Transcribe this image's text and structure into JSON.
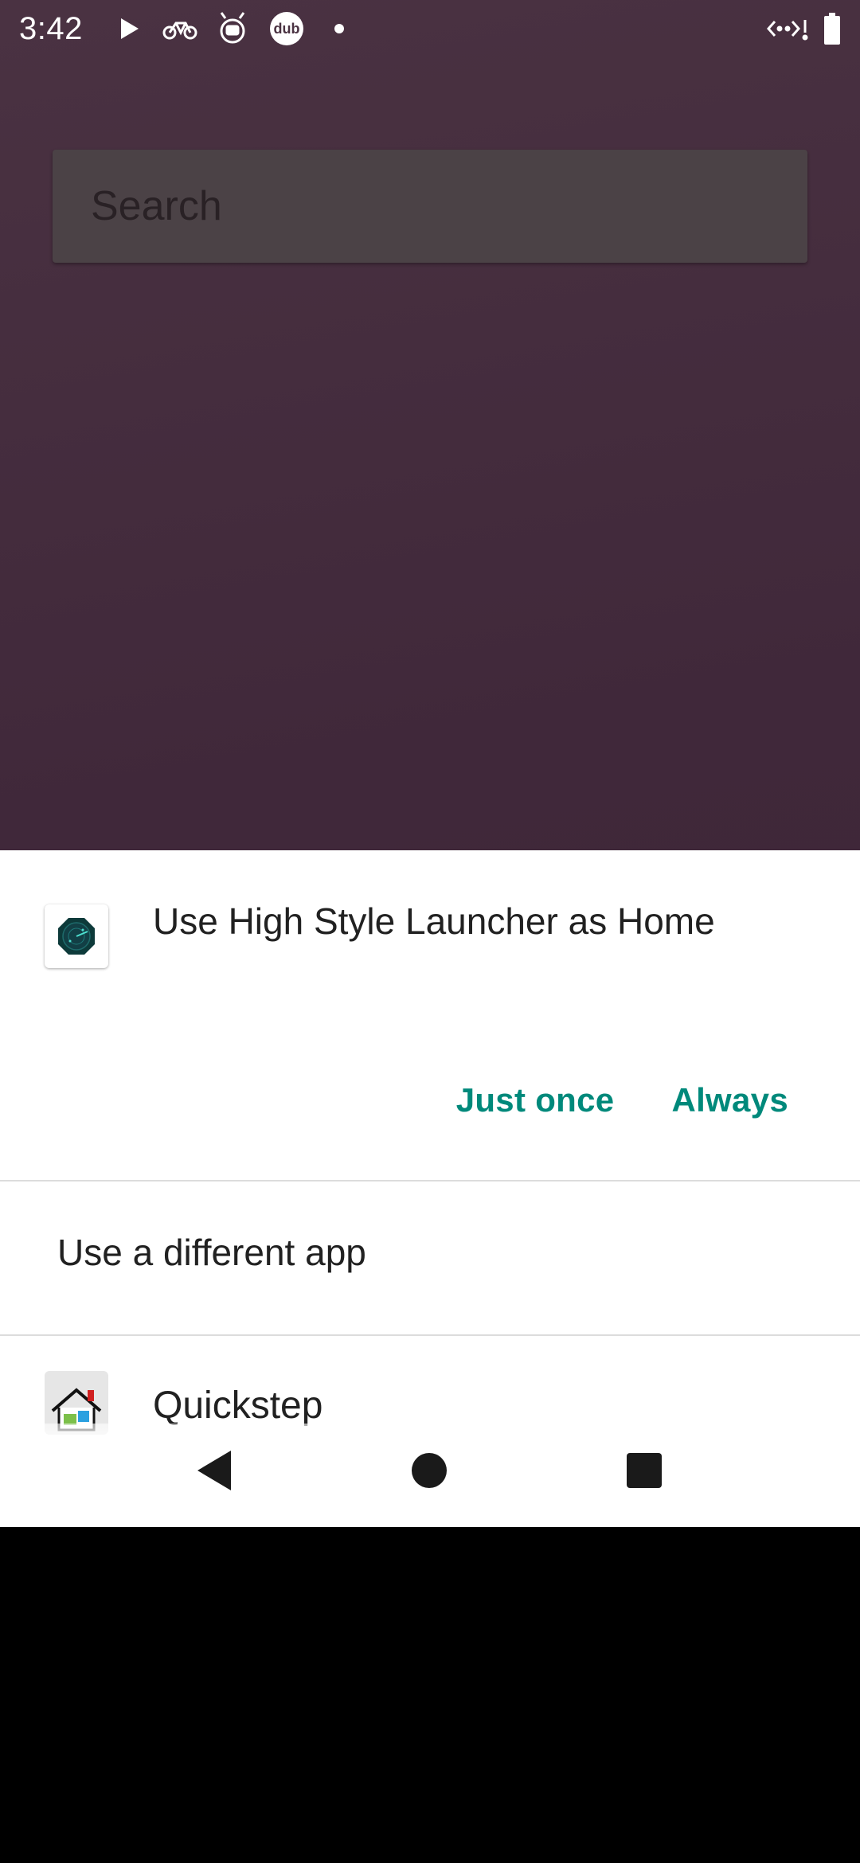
{
  "status_bar": {
    "time": "3:42",
    "icons": [
      "play-icon",
      "bike-icon",
      "bug-icon",
      "dub-icon",
      "dot-icon",
      "wifi-off-icon",
      "battery-icon"
    ],
    "dub_label": "dub"
  },
  "search": {
    "placeholder": "Search"
  },
  "sheet": {
    "title": "Use High Style Launcher as Home",
    "actions": {
      "just_once": "Just once",
      "always": "Always"
    },
    "different_app": "Use a different app",
    "apps": [
      {
        "label": "Quickstep",
        "icon": "home-icon"
      }
    ]
  },
  "nav": {
    "icons": [
      "back-icon",
      "home-icon",
      "recents-icon"
    ]
  },
  "colors": {
    "accent": "#00897b",
    "background": "#442c3d",
    "sheet": "#ffffff",
    "text": "#212121"
  }
}
